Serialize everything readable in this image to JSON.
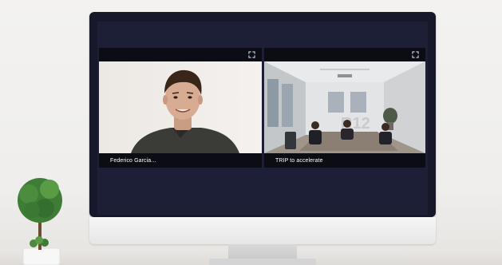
{
  "meeting": {
    "participants": [
      {
        "display_name": "Federico Garcia..."
      },
      {
        "display_name": "TRIP to accelerate"
      }
    ]
  },
  "icons": {
    "expand": "expand-icon"
  },
  "colors": {
    "wall": "#f0efed",
    "monitor_bezel": "#17192a",
    "meeting_background": "#1c1f36",
    "tile_background": "#0b0c14",
    "name_text": "#ffffff"
  }
}
